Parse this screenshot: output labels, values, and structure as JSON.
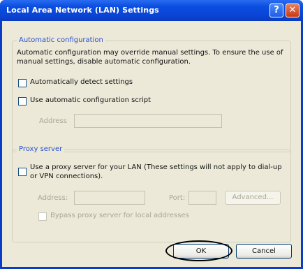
{
  "window": {
    "title": "Local Area Network (LAN) Settings",
    "help_label": "?",
    "close_label": "✕"
  },
  "auto_config": {
    "legend": "Automatic configuration",
    "description": "Automatic configuration may override manual settings. To ensure the use of manual settings, disable automatic configuration.",
    "detect_label": "Automatically detect settings",
    "detect_checked": false,
    "script_label": "Use automatic configuration script",
    "script_checked": false,
    "address_label": "Address",
    "address_value": ""
  },
  "proxy": {
    "legend": "Proxy server",
    "use_proxy_label": "Use a proxy server for your LAN (These settings will not apply to dial-up or VPN connections).",
    "use_proxy_checked": false,
    "address_label": "Address:",
    "address_value": "",
    "port_label": "Port:",
    "port_value": "",
    "advanced_label": "Advanced...",
    "bypass_label": "Bypass proxy server for local addresses",
    "bypass_checked": false
  },
  "buttons": {
    "ok_label": "OK",
    "cancel_label": "Cancel"
  },
  "colors": {
    "titlebar": "#0a45d8",
    "group_legend": "#2a4fcf",
    "dialog_bg": "#ece9d8",
    "annotation_oval": "#000000"
  }
}
